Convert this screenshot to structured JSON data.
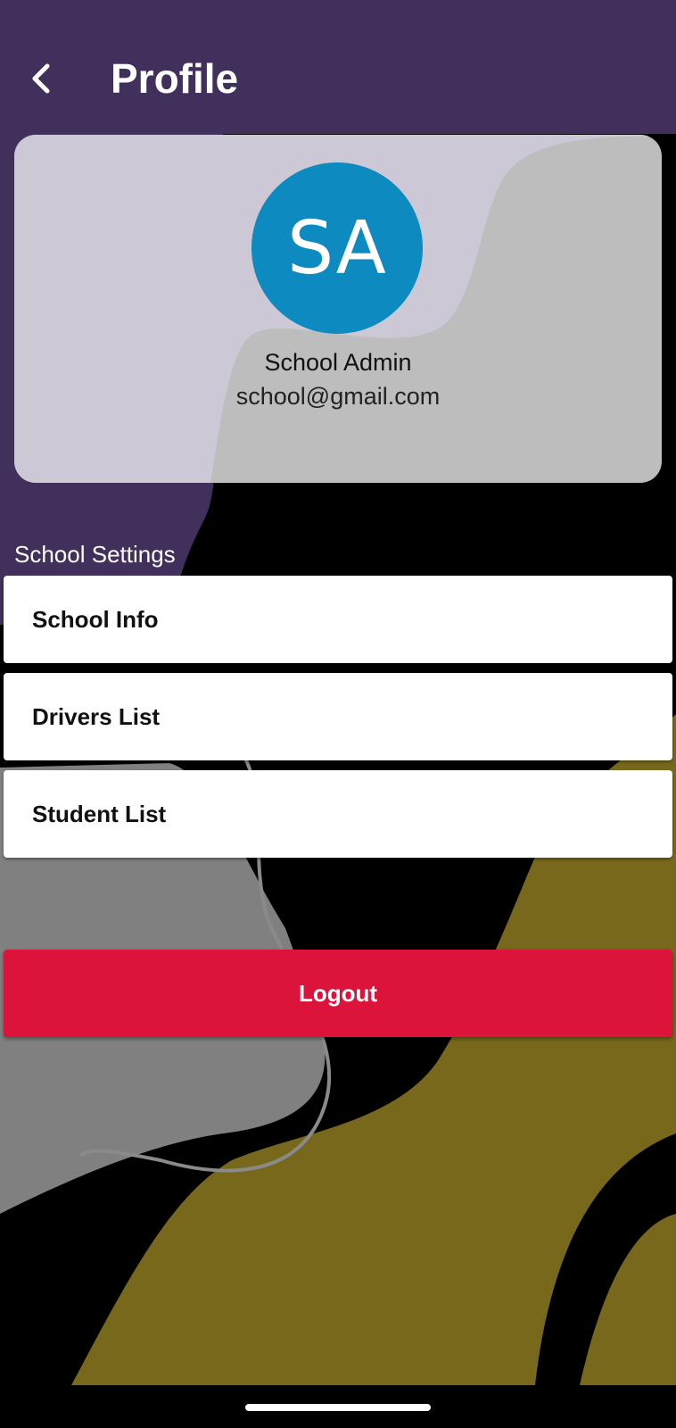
{
  "header": {
    "title": "Profile",
    "back_icon": "chevron-left-icon"
  },
  "profile": {
    "initials": "SA",
    "name": "School Admin",
    "email": "school@gmail.com",
    "avatar_color": "#0d8abf"
  },
  "settings": {
    "section_title": "School Settings",
    "items": [
      {
        "label": "School Info"
      },
      {
        "label": "Drivers List"
      },
      {
        "label": "Student List"
      }
    ]
  },
  "logout": {
    "label": "Logout",
    "color": "#dc143c"
  },
  "theme": {
    "header_purple": "#42305c",
    "olive": "#77681b",
    "gray": "#808080",
    "card_tint": "#ccc8d6"
  }
}
